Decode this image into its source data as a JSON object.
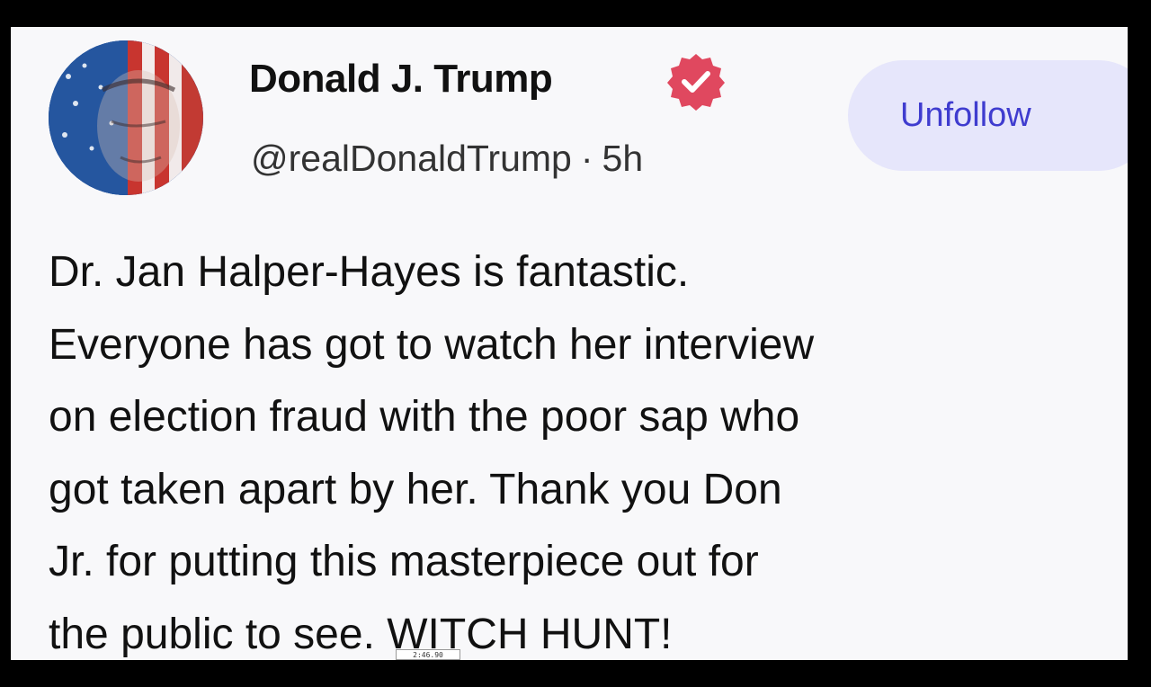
{
  "post": {
    "author": {
      "display_name": "Donald J. Trump",
      "verified_icon": "verified-badge-icon",
      "handle": "@realDonaldTrump",
      "separator": "·",
      "time_ago": "5h"
    },
    "follow_button": {
      "label": "Unfollow"
    },
    "body_lines": [
      "Dr. Jan Halper-Hayes is fantastic.",
      "Everyone has got to watch her interview",
      "on election fraud with the poor sap who",
      "got taken apart by her. Thank you Don",
      "Jr. for putting this masterpiece out for",
      "the public to see. WITCH HUNT!"
    ]
  },
  "video_overlay": {
    "timestamp": "2:46.90"
  },
  "colors": {
    "card_background": "#f8f8fa",
    "button_background": "#e6e6fb",
    "button_text": "#3f3ccf",
    "verified_badge": "#e0485f",
    "frame_background": "#000000"
  }
}
